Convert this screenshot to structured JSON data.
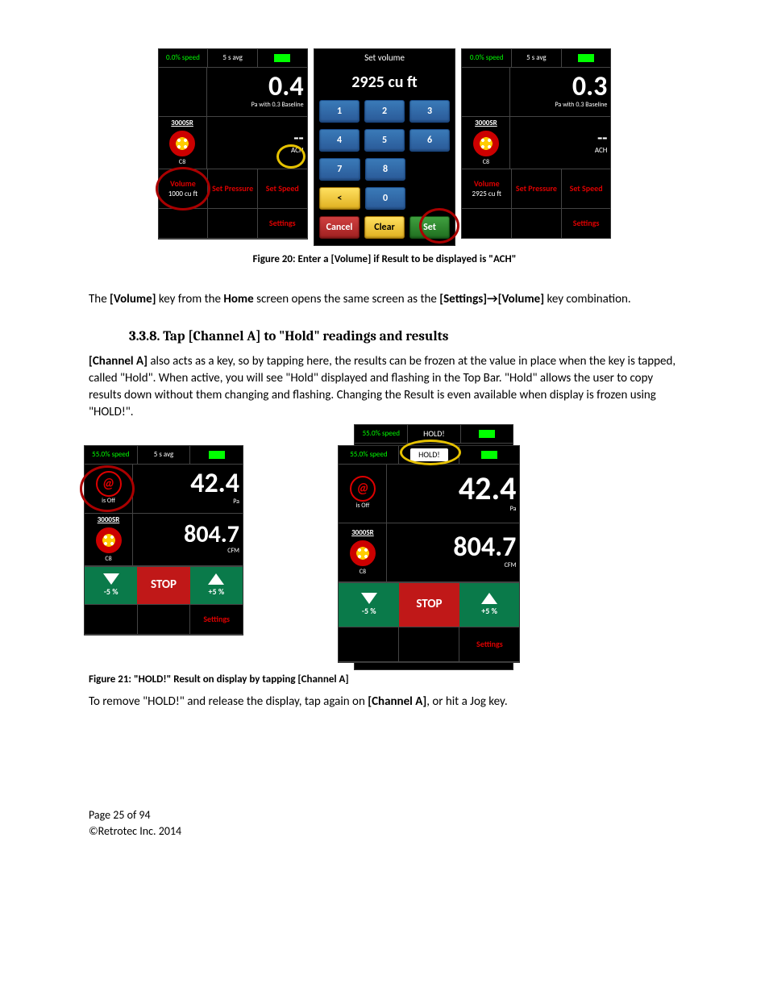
{
  "fig20": {
    "left": {
      "top_speed": "0.0% speed",
      "top_avg": "5 s avg",
      "chA_val": "0.4",
      "chA_sub": "Pa with 0.3 Baseline",
      "model": "3000SR",
      "range": "C8",
      "chB_val": "--",
      "chB_unit": "ACH",
      "volume_label": "Volume",
      "volume_val": "1000 cu ft",
      "set_pressure": "Set Pressure",
      "set_speed": "Set Speed",
      "settings": "Settings"
    },
    "keypad": {
      "title": "Set volume",
      "value": "2925 cu ft",
      "keys": [
        "1",
        "2",
        "3",
        "4",
        "5",
        "6",
        "7",
        "8",
        "",
        "<",
        "0",
        ""
      ],
      "cancel": "Cancel",
      "clear": "Clear",
      "set": "Set"
    },
    "right": {
      "top_speed": "0.0% speed",
      "top_avg": "5 s avg",
      "chA_val": "0.3",
      "chA_sub": "Pa with 0.3 Baseline",
      "model": "3000SR",
      "range": "C8",
      "chB_val": "--",
      "chB_unit": "ACH",
      "volume_label": "Volume",
      "volume_val": "2925 cu ft",
      "set_pressure": "Set Pressure",
      "set_speed": "Set Speed",
      "settings": "Settings"
    },
    "caption": "Figure 20:  Enter a [Volume] if Result to be displayed is \"ACH\""
  },
  "para1_a": "The ",
  "para1_b": "[Volume]",
  "para1_c": " key from the ",
  "para1_d": "Home",
  "para1_e": " screen opens the same screen as the ",
  "para1_f": "[Settings]→[Volume]",
  "para1_g": " key combination.",
  "heading": "3.3.8.  Tap [Channel A] to \"Hold\" readings and results",
  "para2_a": "[Channel A]",
  "para2_b": " also acts as a key, so by tapping here, the results can be frozen at the value in place when the key is tapped, called \"Hold\".  When active, you will see \"Hold\" displayed and flashing in the Top Bar.  \"Hold\" allows the user to copy results down without them changing and flashing.  Changing the Result is even available when display is frozen using \"HOLD!\".",
  "fig21": {
    "left": {
      "top_speed": "55.0% speed",
      "top_avg": "5 s avg",
      "at_label": "is Off",
      "chA_val": "42.4",
      "chA_unit": "Pa",
      "model": "3000SR",
      "range": "C8",
      "chB_val": "804.7",
      "chB_unit": "CFM",
      "jog_down": "-5 %",
      "stop": "STOP",
      "jog_up": "+5 %",
      "settings": "Settings"
    },
    "behind": {
      "top_speed": "55.0% speed",
      "hold": "HOLD!"
    },
    "front": {
      "top_speed": "55.0% speed",
      "hold": "HOLD!",
      "at_label": "is Off",
      "chA_val": "42.4",
      "chA_unit": "Pa",
      "model": "3000SR",
      "range": "C8",
      "chB_val": "804.7",
      "chB_unit": "CFM",
      "jog_down": "-5 %",
      "stop": "STOP",
      "jog_up": "+5 %",
      "settings": "Settings"
    },
    "caption": "Figure 21:  \"HOLD!\" Result on display by tapping [Channel A]"
  },
  "para3_a": "To remove \"HOLD!\" and release the display, tap again on ",
  "para3_b": "[Channel A]",
  "para3_c": ", or hit a Jog key.",
  "footer_page": "Page 25 of 94",
  "footer_copy": "©Retrotec Inc. 2014"
}
